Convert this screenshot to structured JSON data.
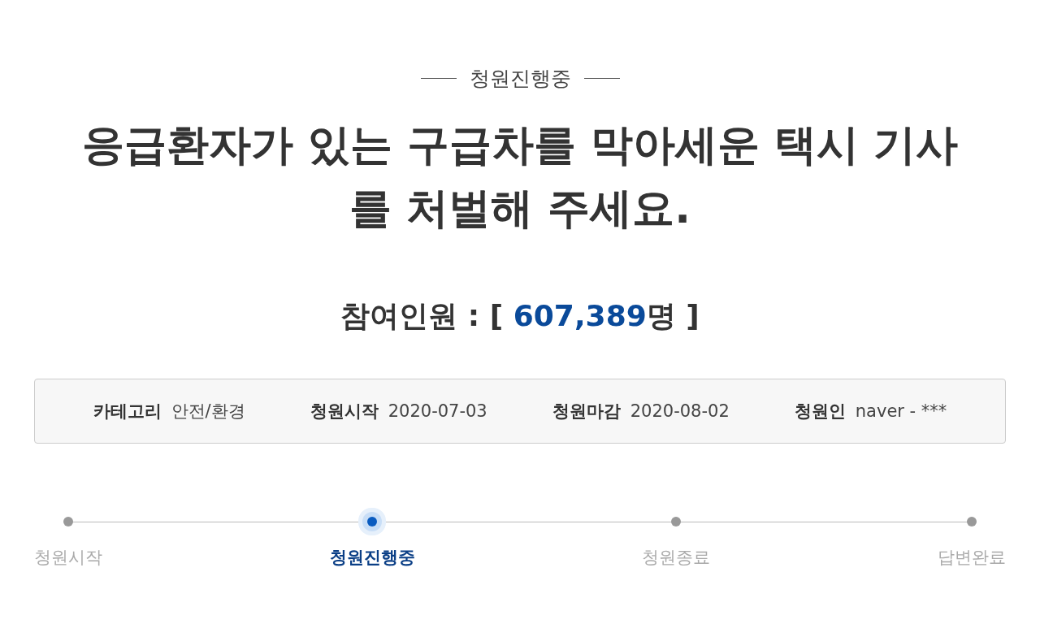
{
  "status_tag": "청원진행중",
  "title_lines": [
    "응급환자가 있는 구급차를 막아세운 택시 기사",
    "를 처벌해 주세요."
  ],
  "participants": {
    "label": "참여인원",
    "colon": ":",
    "open": "[",
    "count": "607,389",
    "unit": "명",
    "close": "]"
  },
  "info": [
    {
      "label": "카테고리",
      "value": "안전/환경"
    },
    {
      "label": "청원시작",
      "value": "2020-07-03"
    },
    {
      "label": "청원마감",
      "value": "2020-08-02"
    },
    {
      "label": "청원인",
      "value": "naver - ***"
    }
  ],
  "steps": [
    {
      "label": "청원시작",
      "selected": false
    },
    {
      "label": "청원진행중",
      "selected": true
    },
    {
      "label": "청원종료",
      "selected": false
    },
    {
      "label": "답변완료",
      "selected": false
    }
  ]
}
